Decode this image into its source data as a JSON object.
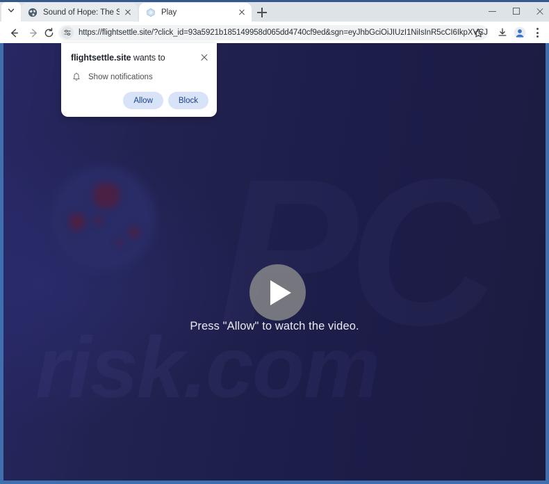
{
  "browser": {
    "tab_search_icon": "chevron-down-icon",
    "tabs": [
      {
        "title": "Sound of Hope: The Story of Po",
        "favicon": "globe-icon",
        "active": false
      },
      {
        "title": "Play",
        "favicon": "play-site-icon",
        "active": true
      }
    ],
    "new_tab_label": "+",
    "window_controls": {
      "minimize": "minimize-icon",
      "maximize": "maximize-icon",
      "close": "close-icon"
    },
    "toolbar": {
      "back": "back-arrow-icon",
      "forward": "forward-arrow-icon",
      "reload": "reload-icon",
      "site_info_icon": "tune-icon",
      "url": "https://flightsettle.site/?click_id=93a5921b185149958d065dd4740cf9ed&sgn=eyJhbGciOiJIUzI1NiIsInR5cCI6IkpXVCJ9.eyJpYXQi...",
      "bookmark_icon": "star-icon",
      "download_icon": "download-icon",
      "profile_icon": "profile-avatar-icon",
      "menu_icon": "three-dot-menu-icon"
    }
  },
  "permission_dialog": {
    "origin": "flightsettle.site",
    "title_suffix": " wants to",
    "close_icon": "close-icon",
    "request_icon": "bell-icon",
    "request_label": "Show notifications",
    "allow_label": "Allow",
    "block_label": "Block"
  },
  "page": {
    "play_button_icon": "play-triangle-icon",
    "caption": "Press \"Allow\" to watch the video.",
    "watermark_primary": "PC",
    "watermark_secondary": "risk.com"
  },
  "colors": {
    "window_frame": "#3f6fae",
    "chrome_bg": "#dee3e8",
    "toolbar_bg": "#ffffff",
    "omnibox_bg": "#f0f2f4",
    "page_bg": "#1d1d4c",
    "button_bg": "#d9e3f7",
    "button_text": "#19418c"
  }
}
